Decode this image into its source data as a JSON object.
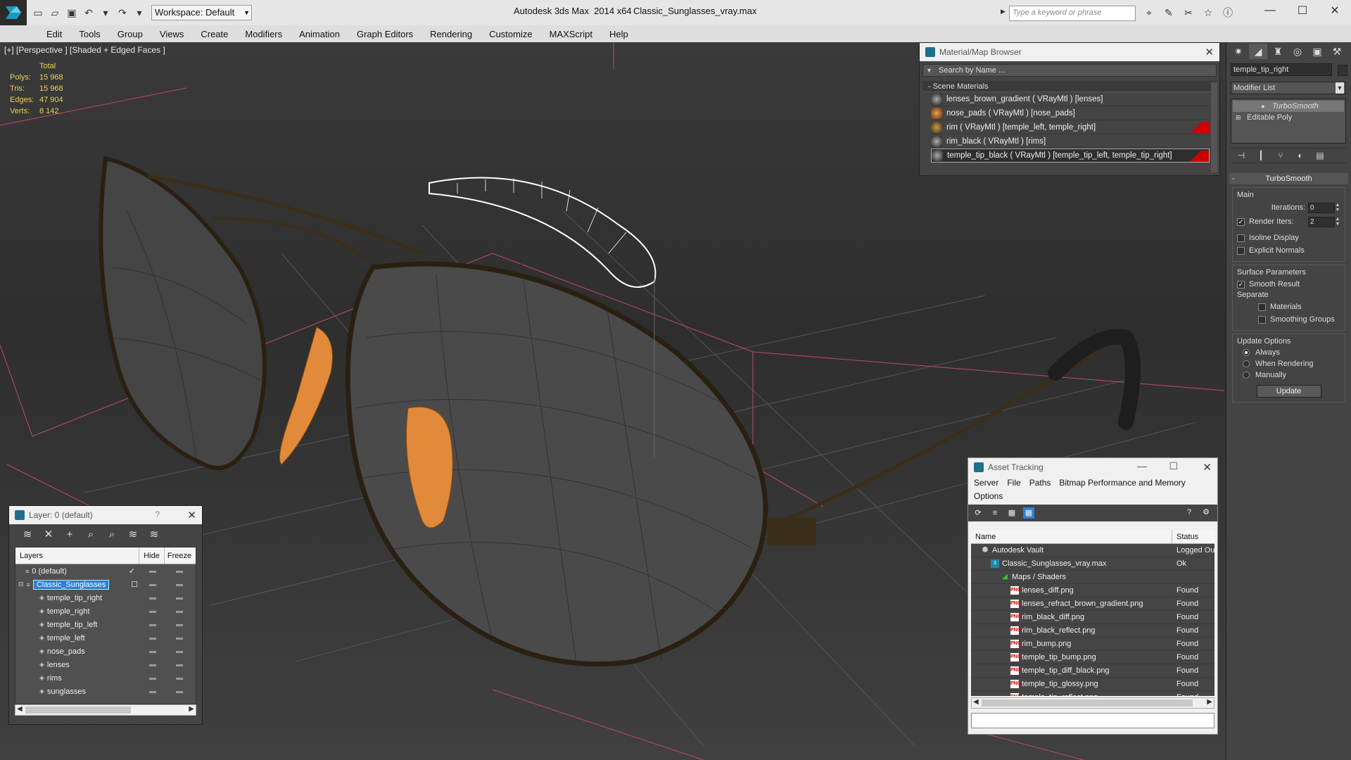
{
  "app": {
    "title": "Autodesk 3ds Max  2014 x64",
    "filename": "Classic_Sunglasses_vray.max",
    "workspace": "Workspace: Default",
    "search_placeholder": "Type a keyword or phrase"
  },
  "menu": [
    "Edit",
    "Tools",
    "Group",
    "Views",
    "Create",
    "Modifiers",
    "Animation",
    "Graph Editors",
    "Rendering",
    "Customize",
    "MAXScript",
    "Help"
  ],
  "viewport": {
    "label": "[+] [Perspective ] [Shaded + Edged Faces ]",
    "stats": {
      "header": "Total",
      "rows": [
        {
          "k": "Polys:",
          "v": "15 968"
        },
        {
          "k": "Tris:",
          "v": "15 968"
        },
        {
          "k": "Edges:",
          "v": "47 904"
        },
        {
          "k": "Verts:",
          "v": "8 142"
        }
      ]
    }
  },
  "material_browser": {
    "title": "Material/Map Browser",
    "search": "Search by Name ...",
    "group": "- Scene Materials",
    "items": [
      {
        "label": "lenses_brown_gradient  ( VRayMtl ) [lenses]",
        "flag": false
      },
      {
        "label": "nose_pads  ( VRayMtl ) [nose_pads]",
        "flag": false
      },
      {
        "label": "rim  ( VRayMtl ) [temple_left, temple_right]",
        "flag": true
      },
      {
        "label": "rim_black  ( VRayMtl ) [rims]",
        "flag": false
      },
      {
        "label": "temple_tip_black  ( VRayMtl ) [temple_tip_left, temple_tip_right]",
        "flag": true
      }
    ]
  },
  "command_panel": {
    "object_name": "temple_tip_right",
    "modifier_list": "Modifier List",
    "stack": [
      "TurboSmooth",
      "Editable Poly"
    ],
    "turbosmooth": {
      "title": "TurboSmooth",
      "main_label": "Main",
      "iterations_label": "Iterations:",
      "iterations": "0",
      "render_iters_label": "Render Iters:",
      "render_iters": "2",
      "isoline": "Isoline Display",
      "explicit_normals": "Explicit Normals",
      "surface_label": "Surface Parameters",
      "smooth_result": "Smooth Result",
      "separate_label": "Separate",
      "materials": "Materials",
      "smoothing_groups": "Smoothing Groups",
      "update_label": "Update Options",
      "always": "Always",
      "when_rendering": "When Rendering",
      "manually": "Manually",
      "update_button": "Update"
    }
  },
  "layer_panel": {
    "title": "Layer: 0 (default)",
    "help": "?",
    "col_layers": "Layers",
    "col_hide": "Hide",
    "col_freeze": "Freeze",
    "rows": [
      {
        "name": "0 (default)",
        "level": 0
      },
      {
        "name": "Classic_Sunglasses",
        "level": 0
      },
      {
        "name": "temple_tip_right",
        "level": 1
      },
      {
        "name": "temple_right",
        "level": 1
      },
      {
        "name": "temple_tip_left",
        "level": 1
      },
      {
        "name": "temple_left",
        "level": 1
      },
      {
        "name": "nose_pads",
        "level": 1
      },
      {
        "name": "lenses",
        "level": 1
      },
      {
        "name": "rims",
        "level": 1
      },
      {
        "name": "sunglasses",
        "level": 1
      }
    ]
  },
  "asset_tracking": {
    "title": "Asset Tracking",
    "menu": [
      "Server",
      "File",
      "Paths",
      "Bitmap Performance and Memory",
      "Options"
    ],
    "col_name": "Name",
    "col_status": "Status",
    "rows": [
      {
        "name": "Autodesk Vault",
        "status": "Logged Ou",
        "indent": 1,
        "icon": "vault"
      },
      {
        "name": "Classic_Sunglasses_vray.max",
        "status": "Ok",
        "indent": 2,
        "icon": "max"
      },
      {
        "name": "Maps / Shaders",
        "status": "",
        "indent": 3,
        "icon": "map"
      },
      {
        "name": "lenses_diff.png",
        "status": "Found",
        "indent": 4,
        "icon": "png"
      },
      {
        "name": "lenses_refract_brown_gradient.png",
        "status": "Found",
        "indent": 4,
        "icon": "png"
      },
      {
        "name": "rim_black_diff.png",
        "status": "Found",
        "indent": 4,
        "icon": "png"
      },
      {
        "name": "rim_black_reflect.png",
        "status": "Found",
        "indent": 4,
        "icon": "png"
      },
      {
        "name": "rim_bump.png",
        "status": "Found",
        "indent": 4,
        "icon": "png"
      },
      {
        "name": "temple_tip_bump.png",
        "status": "Found",
        "indent": 4,
        "icon": "png"
      },
      {
        "name": "temple_tip_diff_black.png",
        "status": "Found",
        "indent": 4,
        "icon": "png"
      },
      {
        "name": "temple_tip_glossy.png",
        "status": "Found",
        "indent": 4,
        "icon": "png"
      },
      {
        "name": "temple_tip_reflect.png",
        "status": "Found",
        "indent": 4,
        "icon": "png"
      }
    ]
  }
}
